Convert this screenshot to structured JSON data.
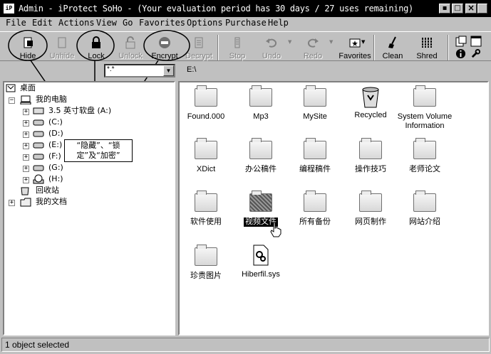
{
  "window": {
    "icon_text": "iP",
    "title": "Admin - iProtect SoHo - (Your evaluation period has 30 days / 27 uses remaining)",
    "min": "▪",
    "max": "□",
    "close": "×"
  },
  "menu": [
    "File",
    "Edit",
    "Actions",
    "View",
    "Go",
    "Favorites",
    "Options",
    "Purchase",
    "Help"
  ],
  "toolbar": {
    "hide": "Hide",
    "unhide": "Unhide",
    "lock": "Lock",
    "unlock": "Unlock",
    "encrypt": "Encrypt",
    "decrypt": "Decrypt",
    "stop": "Stop",
    "undo": "Undo",
    "redo": "Redo",
    "favorites": "Favorites",
    "clean": "Clean",
    "shred": "Shred"
  },
  "filter": {
    "value": "*.*",
    "arrow": "▼"
  },
  "path": "E:\\",
  "tree": {
    "desktop": "桌面",
    "mycomputer": "我的电脑",
    "floppy": "3.5 英寸软盘 (A:)",
    "drives": [
      "(C:)",
      "(D:)",
      "(E:)",
      "(F:)",
      "(G:)",
      "(H:)"
    ],
    "recycle": "回收站",
    "mydocs": "我的文档"
  },
  "callout": {
    "line1": "“隐藏”、“锁",
    "line2": "定”及“加密”"
  },
  "files": [
    "Found.000",
    "Mp3",
    "MySite",
    "Recycled",
    "System Volume Information",
    "XDict",
    "办公稿件",
    "编程稿件",
    "操作技巧",
    "老师论文",
    "软件使用",
    "视频文件",
    "所有备份",
    "网页制作",
    "网站介绍",
    "珍贵图片",
    "Hiberfil.sys"
  ],
  "status": "1 object selected"
}
